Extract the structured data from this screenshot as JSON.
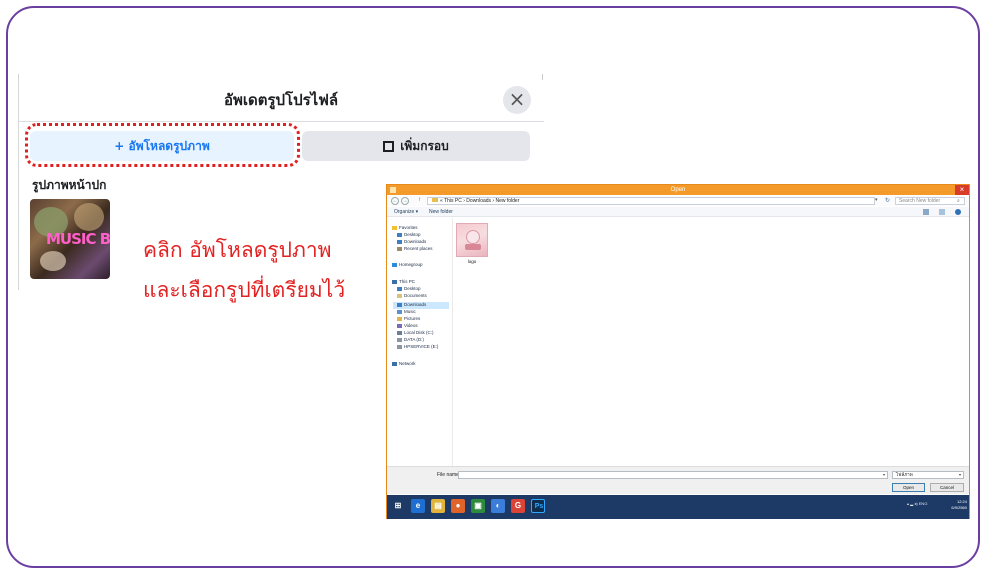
{
  "facebook_dialog": {
    "title": "อัพเดตรูปโปรไฟล์",
    "close_glyph": "×",
    "upload_button": "+ อัพโหลดรูปภาพ",
    "frame_button": "เพิ่มกรอบ",
    "section_label": "รูปภาพหน้าปก",
    "thumbnail_text": "MUSIC BO",
    "colors": {
      "upload_bg": "#e7f3ff",
      "upload_text": "#1877f2",
      "highlight": "#e02020"
    }
  },
  "instruction": {
    "line1": "คลิก อัพโหลดรูปภาพ",
    "line2": "และเลือกรูปที่เตรียมไว้",
    "color": "#e32222"
  },
  "open_dialog": {
    "title": "Open",
    "close_glyph": "×",
    "breadcrumb": "« This PC › Downloads › New folder",
    "search_placeholder": "Search New folder",
    "toolbar": {
      "organize": "Organize ▾",
      "new_folder": "New folder"
    },
    "nav": {
      "favorites": "Favorites",
      "desktop": "Desktop",
      "downloads": "Downloads",
      "recent": "Recent places",
      "homegroup": "Homegroup",
      "this_pc": "This PC",
      "pc_desktop": "Desktop",
      "documents": "Documents",
      "pc_downloads": "Downloads",
      "music": "Music",
      "pictures": "Pictures",
      "videos": "Videos",
      "local_disk": "Local Disk (C:)",
      "data": "DATA (D:)",
      "hpservice": "HPSERVICE (E:)",
      "network": "Network"
    },
    "file": {
      "name": "logo"
    },
    "filename_label": "File name:",
    "filter_value": "ไฟล์ภาพ",
    "open_button": "Open",
    "cancel_button": "Cancel",
    "title_bar_color": "#f39a2b"
  },
  "taskbar": {
    "tray": "▴  ▂ ◂)  ENG",
    "time": "12:24",
    "date": "6/9/2560",
    "apps": [
      {
        "glyph": "⊞",
        "color": "#1d3a66"
      },
      {
        "glyph": "e",
        "color": "#1e6fd1"
      },
      {
        "glyph": "▤",
        "color": "#e2b33a"
      },
      {
        "glyph": "●",
        "color": "#e0632a"
      },
      {
        "glyph": "▣",
        "color": "#2e8b3e"
      },
      {
        "glyph": "◐",
        "color": "#3b7dd8"
      },
      {
        "glyph": "G",
        "color": "#db4437"
      },
      {
        "glyph": "Ps",
        "color": "#0d2e4f"
      }
    ]
  }
}
